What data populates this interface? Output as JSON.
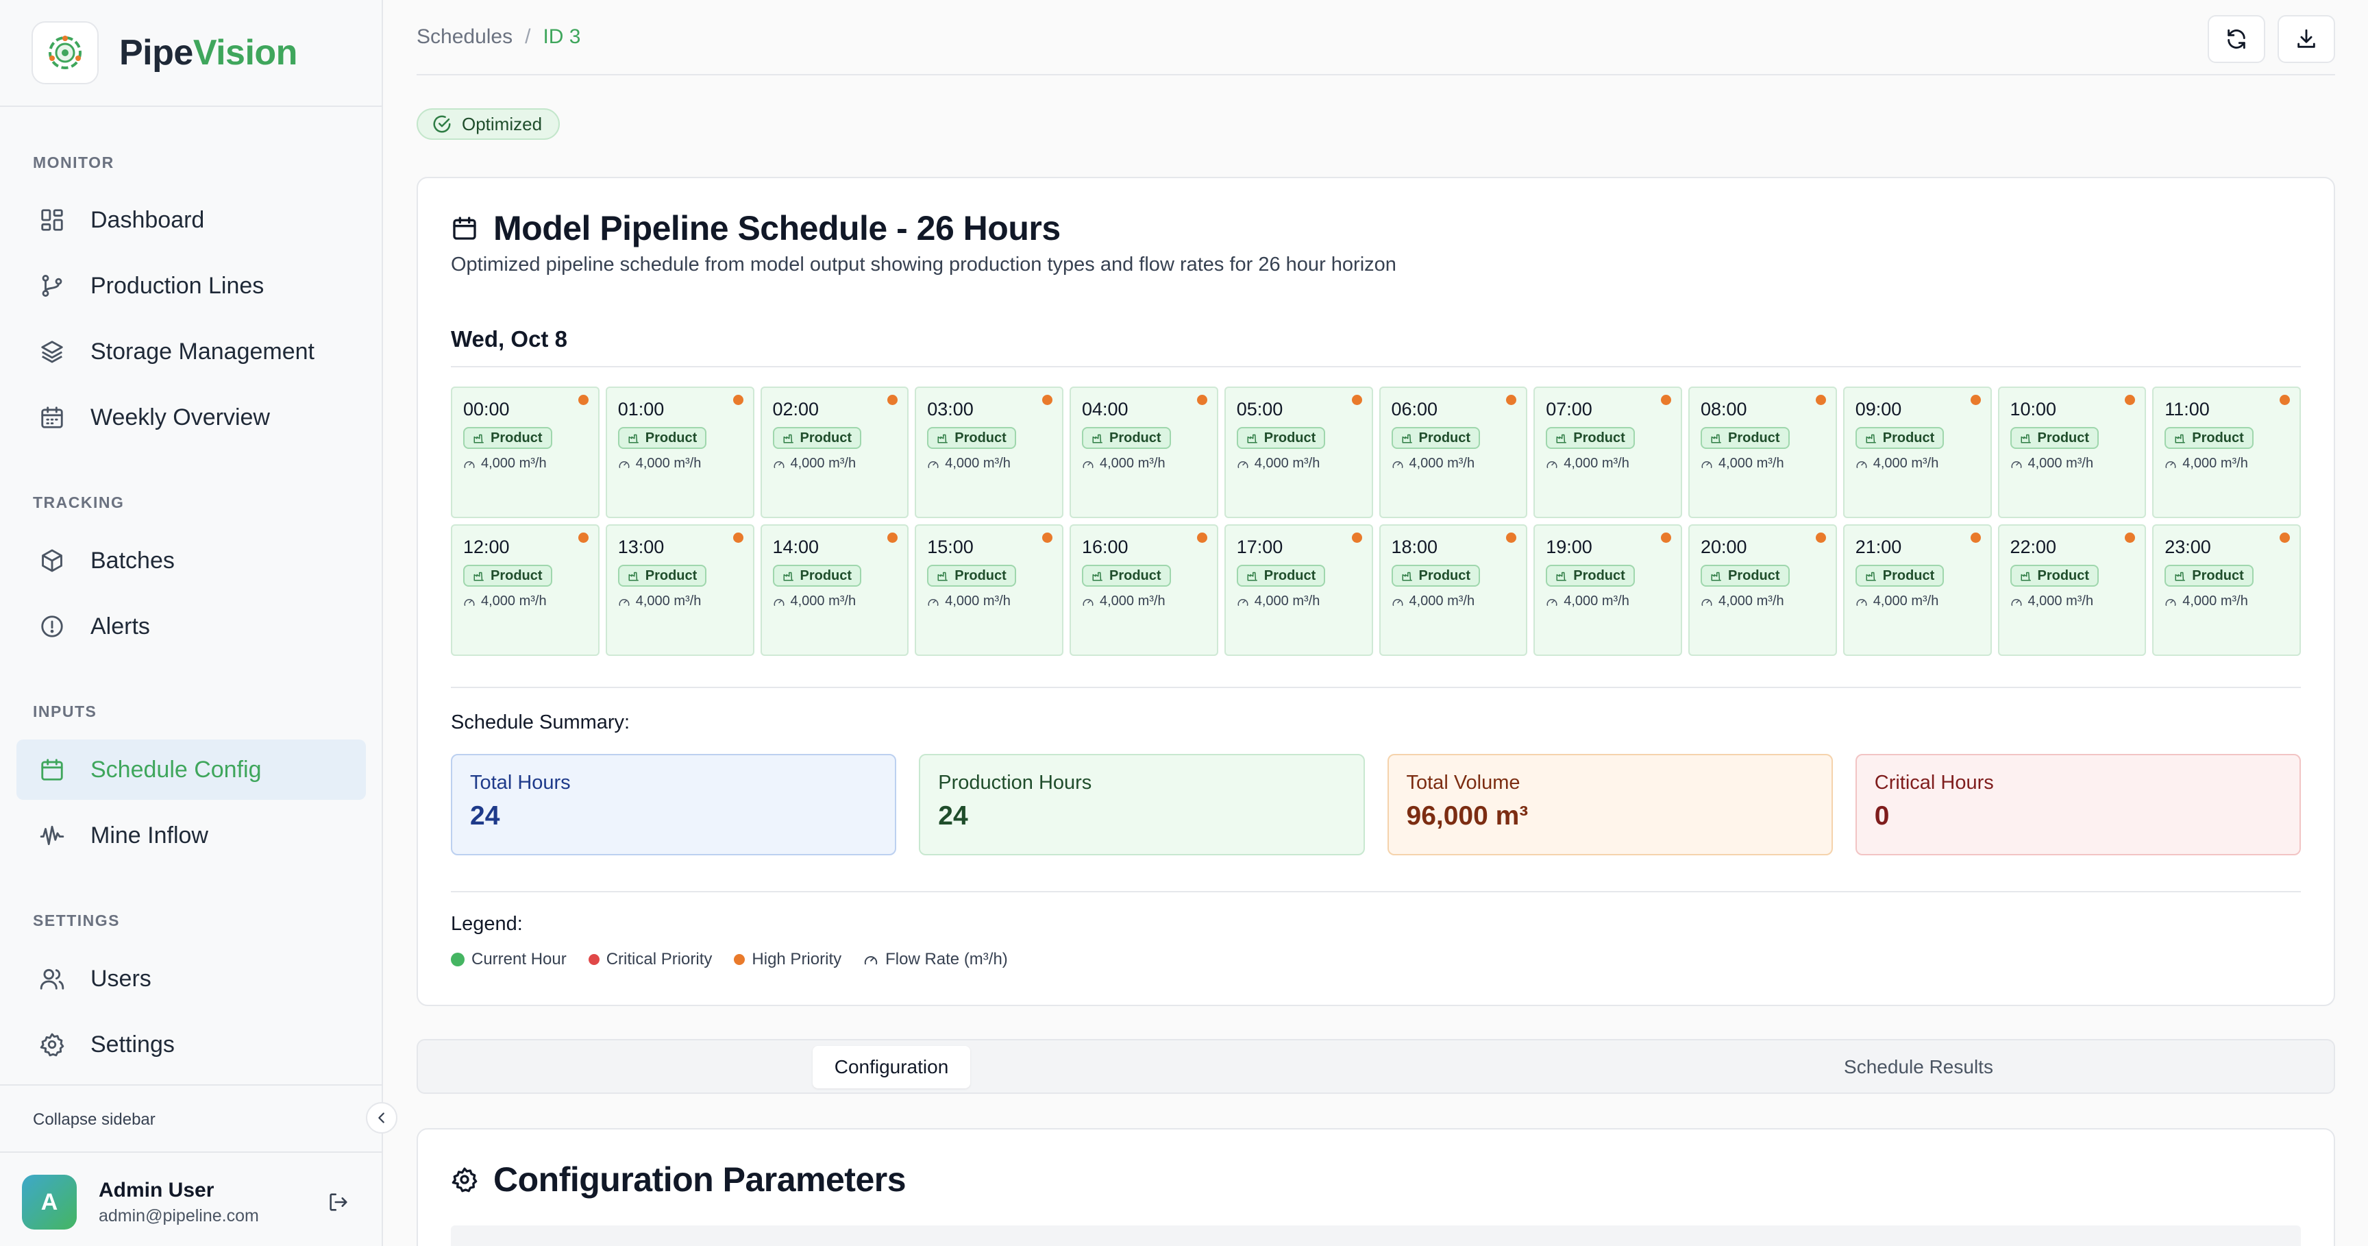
{
  "brand": {
    "name_part1": "Pipe",
    "name_part2": "Vision"
  },
  "sidebar": {
    "sections": {
      "monitor": "MONITOR",
      "tracking": "TRACKING",
      "inputs": "INPUTS",
      "settings": "SETTINGS"
    },
    "items": {
      "dashboard": "Dashboard",
      "production_lines": "Production Lines",
      "storage_management": "Storage Management",
      "weekly_overview": "Weekly Overview",
      "batches": "Batches",
      "alerts": "Alerts",
      "schedule_config": "Schedule Config",
      "mine_inflow": "Mine Inflow",
      "users": "Users",
      "settings": "Settings"
    },
    "active_item": "schedule_config",
    "collapse_label": "Collapse sidebar"
  },
  "user": {
    "initial": "A",
    "name": "Admin User",
    "email": "admin@pipeline.com"
  },
  "breadcrumb": {
    "parent": "Schedules",
    "separator": "/",
    "current": "ID 3"
  },
  "status": {
    "label": "Optimized"
  },
  "schedule": {
    "title": "Model Pipeline Schedule - 26 Hours",
    "description": "Optimized pipeline schedule from model output showing production types and flow rates for 26 hour horizon",
    "date": "Wed, Oct 8",
    "hours": [
      {
        "time": "00:00",
        "type": "Product",
        "flow": "4,000 m³/h"
      },
      {
        "time": "01:00",
        "type": "Product",
        "flow": "4,000 m³/h"
      },
      {
        "time": "02:00",
        "type": "Product",
        "flow": "4,000 m³/h"
      },
      {
        "time": "03:00",
        "type": "Product",
        "flow": "4,000 m³/h"
      },
      {
        "time": "04:00",
        "type": "Product",
        "flow": "4,000 m³/h"
      },
      {
        "time": "05:00",
        "type": "Product",
        "flow": "4,000 m³/h"
      },
      {
        "time": "06:00",
        "type": "Product",
        "flow": "4,000 m³/h"
      },
      {
        "time": "07:00",
        "type": "Product",
        "flow": "4,000 m³/h"
      },
      {
        "time": "08:00",
        "type": "Product",
        "flow": "4,000 m³/h"
      },
      {
        "time": "09:00",
        "type": "Product",
        "flow": "4,000 m³/h"
      },
      {
        "time": "10:00",
        "type": "Product",
        "flow": "4,000 m³/h"
      },
      {
        "time": "11:00",
        "type": "Product",
        "flow": "4,000 m³/h"
      },
      {
        "time": "12:00",
        "type": "Product",
        "flow": "4,000 m³/h"
      },
      {
        "time": "13:00",
        "type": "Product",
        "flow": "4,000 m³/h"
      },
      {
        "time": "14:00",
        "type": "Product",
        "flow": "4,000 m³/h"
      },
      {
        "time": "15:00",
        "type": "Product",
        "flow": "4,000 m³/h"
      },
      {
        "time": "16:00",
        "type": "Product",
        "flow": "4,000 m³/h"
      },
      {
        "time": "17:00",
        "type": "Product",
        "flow": "4,000 m³/h"
      },
      {
        "time": "18:00",
        "type": "Product",
        "flow": "4,000 m³/h"
      },
      {
        "time": "19:00",
        "type": "Product",
        "flow": "4,000 m³/h"
      },
      {
        "time": "20:00",
        "type": "Product",
        "flow": "4,000 m³/h"
      },
      {
        "time": "21:00",
        "type": "Product",
        "flow": "4,000 m³/h"
      },
      {
        "time": "22:00",
        "type": "Product",
        "flow": "4,000 m³/h"
      },
      {
        "time": "23:00",
        "type": "Product",
        "flow": "4,000 m³/h"
      }
    ],
    "summary_title": "Schedule Summary:",
    "summary": {
      "total_hours": {
        "label": "Total Hours",
        "value": "24"
      },
      "production_hours": {
        "label": "Production Hours",
        "value": "24"
      },
      "total_volume": {
        "label": "Total Volume",
        "value": "96,000 m³"
      },
      "critical_hours": {
        "label": "Critical Hours",
        "value": "0"
      }
    },
    "legend_title": "Legend:",
    "legend": {
      "current_hour": "Current Hour",
      "critical_priority": "Critical Priority",
      "high_priority": "High Priority",
      "flow_rate": "Flow Rate (m³/h)"
    }
  },
  "tabs": {
    "configuration": "Configuration",
    "schedule_results": "Schedule Results",
    "active": "configuration"
  },
  "config": {
    "title": "Configuration Parameters"
  },
  "colors": {
    "brand_green": "#3fa65c",
    "current_hour": "#45b562",
    "critical_priority": "#e04848",
    "high_priority": "#e97a2b"
  }
}
